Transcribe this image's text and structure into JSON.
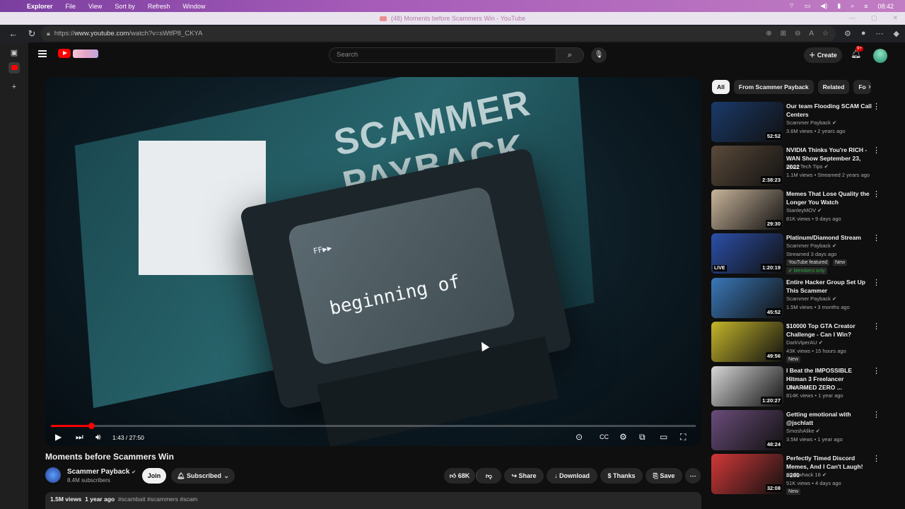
{
  "menubar": {
    "items": [
      "Explorer",
      "File",
      "View",
      "Sort by",
      "Refresh",
      "Window"
    ],
    "time": "08:42"
  },
  "window_title": "(48) Moments before Scammers Win - YouTube",
  "address": {
    "prefix": "https://",
    "host": "www.youtube.com",
    "path": "/watch?v=sWtfP8_CKYA"
  },
  "header": {
    "search_placeholder": "Search",
    "create_label": "Create",
    "notif_badge": "9+"
  },
  "player": {
    "screen_text": "beginning of",
    "ff_text": "FF▶▶",
    "poster_text": "SCAMMER PAYBACK",
    "time": "1:43 / 27:50",
    "progress_fraction": 0.062
  },
  "video": {
    "title": "Moments before Scammers Win",
    "channel": "Scammer Payback",
    "subscribers": "8.4M subscribers",
    "join_label": "Join",
    "subscribed_label": "Subscribed",
    "likes": "68K",
    "share_label": "Share",
    "download_label": "Download",
    "thanks_label": "Thanks",
    "save_label": "Save",
    "views": "1.5M views",
    "age": "1 year ago",
    "hashtags": "#scambait #scammers #scam"
  },
  "chips": [
    "All",
    "From Scammer Payback",
    "Related",
    "Fo"
  ],
  "recommendations": [
    {
      "title": "Our team Flooding SCAM Call Centers",
      "channel": "Scammer Payback",
      "meta": "3.6M views • 2 years ago",
      "duration": "52:52",
      "thumb_color": "#1a3a6a"
    },
    {
      "title": "NVIDIA Thinks You're RICH - WAN Show September 23, 2022",
      "channel": "Linus Tech Tips",
      "meta": "1.1M views • Streamed 2 years ago",
      "duration": "2:38:23",
      "thumb_color": "#5a4a3a"
    },
    {
      "title": "Memes That Lose Quality the Longer You Watch",
      "channel": "StanleyMOV",
      "meta": "81K views • 9 days ago",
      "duration": "29:30",
      "thumb_color": "#c9b49a"
    },
    {
      "title": "Platinum/Diamond Stream",
      "channel": "Scammer Payback",
      "meta": "Streamed 3 days ago",
      "duration": "1:20:19",
      "thumb_color": "#2b4fa8",
      "live": "LIVE",
      "tag": "YouTube featured",
      "tag_new": "New",
      "members": "Members only"
    },
    {
      "title": "Entire Hacker Group Set Up This Scammer",
      "channel": "Scammer Payback",
      "meta": "1.5M views • 3 months ago",
      "duration": "45:52",
      "thumb_color": "#3a78b8"
    },
    {
      "title": "$10000 Top GTA Creator Challenge - Can I Win?",
      "channel": "DarkViperAU",
      "meta": "43K views • 15 hours ago",
      "duration": "49:56",
      "thumb_color": "#c4b52a",
      "tag": "New"
    },
    {
      "title": "I Beat the IMPOSSIBLE Hitman 3 Freelancer UNARMED ZERO ...",
      "channel": "Cheru",
      "meta": "814K views • 1 year ago",
      "duration": "1:20:27",
      "thumb_color": "#d7d7d7"
    },
    {
      "title": "Getting emotional with @jschlatt",
      "channel": "SmoshAlike",
      "meta": "3.5M views • 1 year ago",
      "duration": "48:24",
      "thumb_color": "#6a4c7a"
    },
    {
      "title": "Perfectly Timed Discord Memes, And I Can't Laugh! #260",
      "channel": "Bushwhack 18",
      "meta": "51K views • 4 days ago",
      "duration": "32:08",
      "thumb_color": "#d23838",
      "tag": "New"
    }
  ],
  "colors": {
    "accent": "#ff0000",
    "bg": "#0f0f0f",
    "menubar": "#a55bb8"
  }
}
